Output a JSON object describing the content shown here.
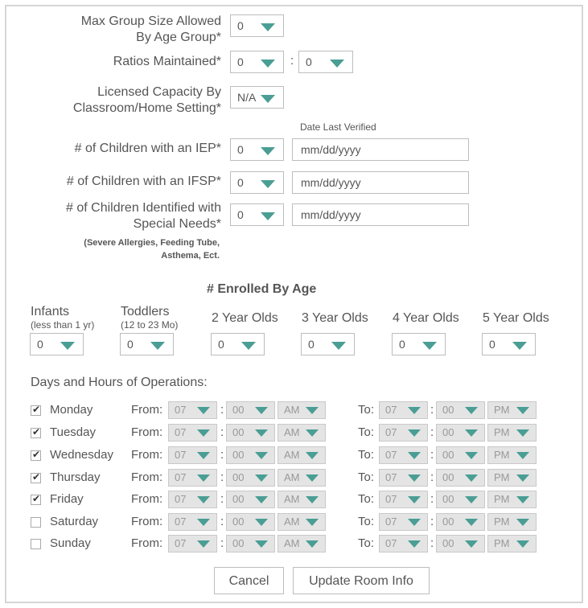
{
  "fields": {
    "max_group": {
      "label1": "Max Group Size Allowed",
      "label2": "By Age Group*",
      "value": "0"
    },
    "ratios": {
      "label": "Ratios Maintained*",
      "value_left": "0",
      "separator": ":",
      "value_right": "0"
    },
    "licensed": {
      "label1": "Licensed Capacity By",
      "label2": "Classroom/Home Setting*",
      "value": "N/A"
    },
    "date_header": "Date Last Verified",
    "iep": {
      "label": "# of Children with an IEP*",
      "value": "0",
      "date_placeholder": "mm/dd/yyyy"
    },
    "ifsp": {
      "label": "# of Children with an IFSP*",
      "value": "0",
      "date_placeholder": "mm/dd/yyyy"
    },
    "special": {
      "label1": "# of Children Identified with",
      "label2": "Special Needs*",
      "value": "0",
      "date_placeholder": "mm/dd/yyyy",
      "note1": "(Severe Allergies, Feeding Tube,",
      "note2": "Asthema, Ect."
    }
  },
  "enrolled": {
    "heading": "# Enrolled By Age",
    "groups": [
      {
        "label": "Infants",
        "sub": "(less than 1 yr)",
        "value": "0"
      },
      {
        "label": "Toddlers",
        "sub": "(12 to 23 Mo)",
        "value": "0"
      },
      {
        "label": "2 Year Olds",
        "sub": "",
        "value": "0"
      },
      {
        "label": "3 Year Olds",
        "sub": "",
        "value": "0"
      },
      {
        "label": "4 Year Olds",
        "sub": "",
        "value": "0"
      },
      {
        "label": "5 Year Olds",
        "sub": "",
        "value": "0"
      }
    ]
  },
  "hours": {
    "heading": "Days and Hours of Operations:",
    "from_label": "From:",
    "to_label": "To:",
    "separator": ":",
    "days": [
      {
        "name": "Monday",
        "checked": true,
        "from_h": "07",
        "from_m": "00",
        "from_ap": "AM",
        "to_h": "07",
        "to_m": "00",
        "to_ap": "PM"
      },
      {
        "name": "Tuesday",
        "checked": true,
        "from_h": "07",
        "from_m": "00",
        "from_ap": "AM",
        "to_h": "07",
        "to_m": "00",
        "to_ap": "PM"
      },
      {
        "name": "Wednesday",
        "checked": true,
        "from_h": "07",
        "from_m": "00",
        "from_ap": "AM",
        "to_h": "07",
        "to_m": "00",
        "to_ap": "PM"
      },
      {
        "name": "Thursday",
        "checked": true,
        "from_h": "07",
        "from_m": "00",
        "from_ap": "AM",
        "to_h": "07",
        "to_m": "00",
        "to_ap": "PM"
      },
      {
        "name": "Friday",
        "checked": true,
        "from_h": "07",
        "from_m": "00",
        "from_ap": "AM",
        "to_h": "07",
        "to_m": "00",
        "to_ap": "PM"
      },
      {
        "name": "Saturday",
        "checked": false,
        "from_h": "07",
        "from_m": "00",
        "from_ap": "AM",
        "to_h": "07",
        "to_m": "00",
        "to_ap": "PM"
      },
      {
        "name": "Sunday",
        "checked": false,
        "from_h": "07",
        "from_m": "00",
        "from_ap": "AM",
        "to_h": "07",
        "to_m": "00",
        "to_ap": "PM"
      }
    ]
  },
  "buttons": {
    "cancel": "Cancel",
    "update": "Update Room Info"
  },
  "colors": {
    "accent": "#4a9e94",
    "border": "#bdbdbd",
    "disabled_bg": "#e4e4e4"
  }
}
